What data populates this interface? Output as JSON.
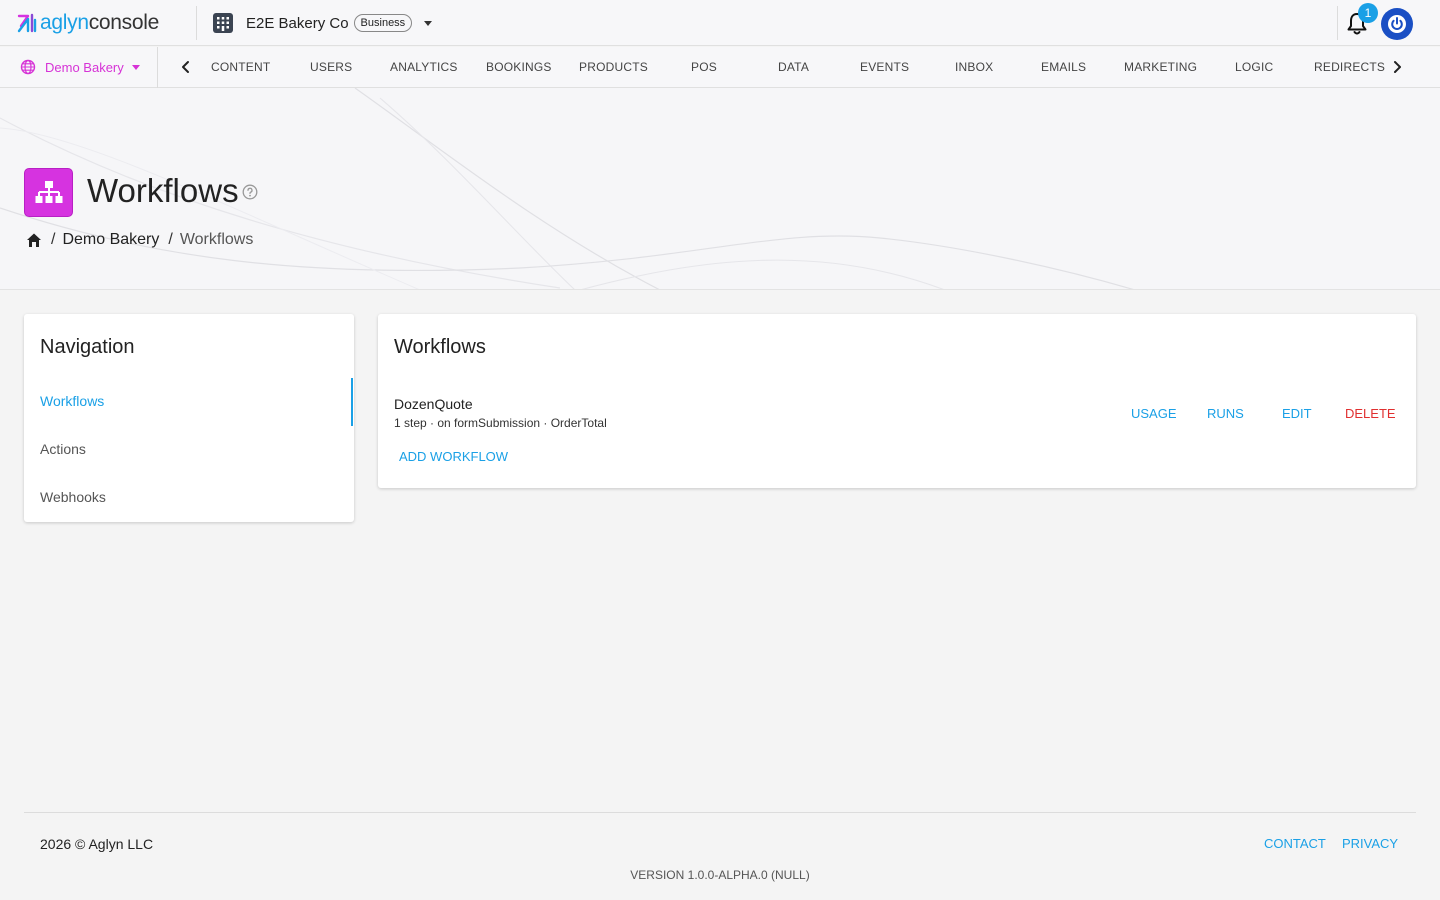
{
  "app": {
    "brand": "aglyn",
    "product": "console"
  },
  "org": {
    "name": "E2E Bakery Co",
    "plan": "Business"
  },
  "notifications": {
    "count": "1"
  },
  "site": {
    "name": "Demo Bakery"
  },
  "tabs": [
    {
      "label": "CONTENT"
    },
    {
      "label": "USERS"
    },
    {
      "label": "ANALYTICS"
    },
    {
      "label": "BOOKINGS"
    },
    {
      "label": "PRODUCTS"
    },
    {
      "label": "POS"
    },
    {
      "label": "DATA"
    },
    {
      "label": "EVENTS"
    },
    {
      "label": "INBOX"
    },
    {
      "label": "EMAILS"
    },
    {
      "label": "MARKETING"
    },
    {
      "label": "LOGIC"
    },
    {
      "label": "REDIRECTS"
    }
  ],
  "header": {
    "title": "Workflows",
    "breadcrumb": [
      "Demo Bakery",
      "Workflows"
    ]
  },
  "navigation": {
    "title": "Navigation",
    "items": [
      {
        "label": "Workflows",
        "active": true
      },
      {
        "label": "Actions",
        "active": false
      },
      {
        "label": "Webhooks",
        "active": false
      }
    ]
  },
  "workflows": {
    "title": "Workflows",
    "items": [
      {
        "name": "DozenQuote",
        "meta": "1 step · on formSubmission · OrderTotal",
        "actions": {
          "usage": "USAGE",
          "runs": "RUNS",
          "edit": "EDIT",
          "delete": "DELETE"
        }
      }
    ],
    "add_label": "ADD WORKFLOW"
  },
  "footer": {
    "copyright": "2026 © Aglyn LLC",
    "contact": "CONTACT",
    "privacy": "PRIVACY",
    "version": "VERSION 1.0.0-ALPHA.0 (NULL)"
  },
  "colors": {
    "accent": "#1aa0e6",
    "brand_magenta": "#d633e0",
    "danger": "#e03030",
    "power_button": "#1a4fc4"
  },
  "icons": {
    "logo": "aglyn-logo-icon",
    "org": "building-icon",
    "bell": "bell-icon",
    "power": "power-icon",
    "site": "globe-icon",
    "page": "sitemap-icon",
    "help": "help-circle-icon",
    "home": "home-icon"
  }
}
